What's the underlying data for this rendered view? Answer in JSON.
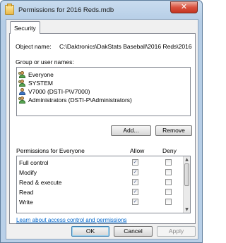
{
  "window": {
    "title": "Permissions for 2016 Reds.mdb",
    "close_symbol": "✕"
  },
  "tabs": [
    {
      "label": "Security"
    }
  ],
  "object_name": {
    "label": "Object name:",
    "value": "C:\\Daktronics\\DakStats Baseball\\2016 Reds\\2016"
  },
  "group_users": {
    "label": "Group or user names:",
    "items": [
      {
        "name": "Everyone",
        "icon": "group-icon"
      },
      {
        "name": "SYSTEM",
        "icon": "group-icon"
      },
      {
        "name": "V7000 (DSTI-P\\V7000)",
        "icon": "user-icon"
      },
      {
        "name": "Administrators (DSTI-P\\Administrators)",
        "icon": "group-icon"
      }
    ]
  },
  "buttons": {
    "add": "Add...",
    "remove": "Remove",
    "ok": "OK",
    "cancel": "Cancel",
    "apply": "Apply"
  },
  "permissions": {
    "header": "Permissions for Everyone",
    "allow_label": "Allow",
    "deny_label": "Deny",
    "check_symbol": "✓",
    "rows": [
      {
        "name": "Full control",
        "allow": true,
        "deny": false
      },
      {
        "name": "Modify",
        "allow": true,
        "deny": false
      },
      {
        "name": "Read & execute",
        "allow": true,
        "deny": false
      },
      {
        "name": "Read",
        "allow": true,
        "deny": false
      },
      {
        "name": "Write",
        "allow": true,
        "deny": false
      }
    ]
  },
  "scrollbar": {
    "up_symbol": "▲",
    "down_symbol": "▼"
  },
  "learn_link": "Learn about access control and permissions"
}
